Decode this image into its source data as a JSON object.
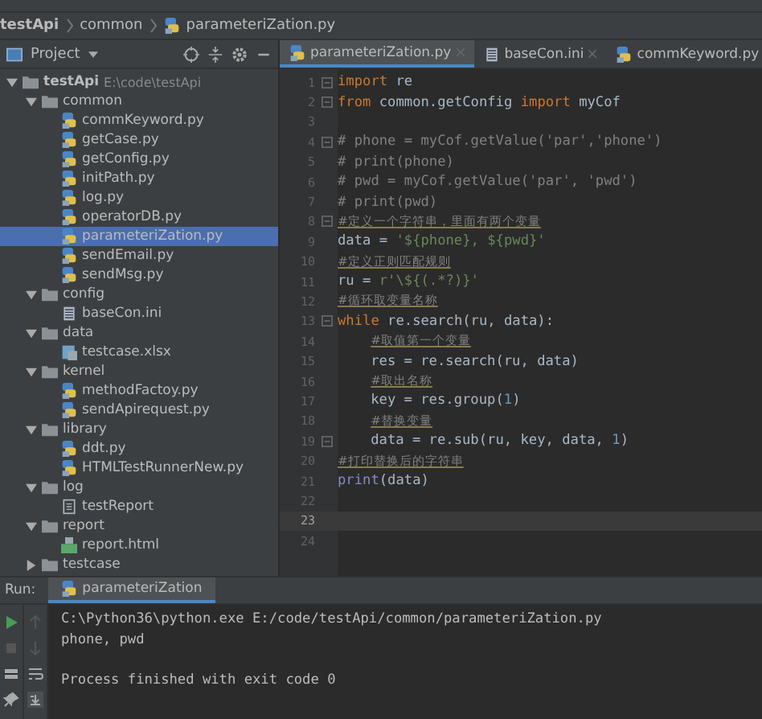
{
  "breadcrumb": [
    "testApi",
    "common",
    "parameteriZation.py"
  ],
  "project_panel": {
    "title": "Project",
    "tree": [
      {
        "label": "testApi",
        "hint": "E:\\code\\testApi",
        "kind": "folder",
        "expanded": true,
        "selected": false,
        "children": [
          {
            "label": "common",
            "kind": "folder",
            "expanded": true,
            "selected": false,
            "children": [
              {
                "label": "commKeyword.py",
                "kind": "py",
                "selected": false
              },
              {
                "label": "getCase.py",
                "kind": "py",
                "selected": false
              },
              {
                "label": "getConfig.py",
                "kind": "py",
                "selected": false
              },
              {
                "label": "initPath.py",
                "kind": "py",
                "selected": false
              },
              {
                "label": "log.py",
                "kind": "py",
                "selected": false
              },
              {
                "label": "operatorDB.py",
                "kind": "py",
                "selected": false
              },
              {
                "label": "parameteriZation.py",
                "kind": "py",
                "selected": true
              },
              {
                "label": "sendEmail.py",
                "kind": "py",
                "selected": false
              },
              {
                "label": "sendMsg.py",
                "kind": "py",
                "selected": false
              }
            ]
          },
          {
            "label": "config",
            "kind": "folder",
            "expanded": true,
            "selected": false,
            "children": [
              {
                "label": "baseCon.ini",
                "kind": "ini",
                "selected": false
              }
            ]
          },
          {
            "label": "data",
            "kind": "folder",
            "expanded": true,
            "selected": false,
            "children": [
              {
                "label": "testcase.xlsx",
                "kind": "xlsx",
                "selected": false
              }
            ]
          },
          {
            "label": "kernel",
            "kind": "folder",
            "expanded": true,
            "selected": false,
            "children": [
              {
                "label": "methodFactoy.py",
                "kind": "py",
                "selected": false
              },
              {
                "label": "sendApirequest.py",
                "kind": "py",
                "selected": false
              }
            ]
          },
          {
            "label": "library",
            "kind": "folder",
            "expanded": true,
            "selected": false,
            "children": [
              {
                "label": "ddt.py",
                "kind": "py",
                "selected": false
              },
              {
                "label": "HTMLTestRunnerNew.py",
                "kind": "py",
                "selected": false
              }
            ]
          },
          {
            "label": "log",
            "kind": "folder",
            "expanded": true,
            "selected": false,
            "children": [
              {
                "label": "testReport",
                "kind": "file",
                "selected": false
              }
            ]
          },
          {
            "label": "report",
            "kind": "folder",
            "expanded": true,
            "selected": false,
            "children": [
              {
                "label": "report.html",
                "kind": "html",
                "selected": false
              }
            ]
          },
          {
            "label": "testcase",
            "kind": "folder",
            "expanded": false,
            "selected": false
          }
        ]
      }
    ]
  },
  "editor_tabs": [
    {
      "label": "parameteriZation.py",
      "kind": "py",
      "selected": true
    },
    {
      "label": "baseCon.ini",
      "kind": "ini",
      "selected": false
    },
    {
      "label": "commKeyword.py",
      "kind": "py",
      "selected": false
    }
  ],
  "code_lines": [
    {
      "number": "1",
      "fold": true,
      "current": false,
      "indented": false,
      "tokens": [
        {
          "kind": "keyword",
          "text": "import"
        },
        {
          "kind": "plain",
          "text": " re"
        }
      ]
    },
    {
      "number": "2",
      "fold": true,
      "current": false,
      "indented": false,
      "tokens": [
        {
          "kind": "keyword",
          "text": "from"
        },
        {
          "kind": "plain",
          "text": " common.getConfig "
        },
        {
          "kind": "keyword",
          "text": "import"
        },
        {
          "kind": "plain",
          "text": " myCof"
        }
      ]
    },
    {
      "number": "3",
      "fold": false,
      "current": false
    },
    {
      "number": "4",
      "fold": true,
      "current": false,
      "indented": false,
      "tokens": [
        {
          "kind": "comment",
          "text": "# phone = myCof.getValue('par','phone')"
        }
      ]
    },
    {
      "number": "5",
      "fold": false,
      "current": false,
      "indented": false,
      "tokens": [
        {
          "kind": "comment",
          "text": "# print(phone)"
        }
      ]
    },
    {
      "number": "6",
      "fold": false,
      "current": false,
      "indented": false,
      "tokens": [
        {
          "kind": "comment",
          "text": "# pwd = myCof.getValue('par', 'pwd')"
        }
      ]
    },
    {
      "number": "7",
      "fold": false,
      "current": false,
      "indented": false,
      "tokens": [
        {
          "kind": "comment",
          "text": "# print(pwd)"
        }
      ]
    },
    {
      "number": "8",
      "fold": true,
      "current": false,
      "indented": false,
      "tokens": [
        {
          "kind": "typo",
          "text": "#定义一个字符串，里面有两个变量"
        }
      ]
    },
    {
      "number": "9",
      "fold": false,
      "current": false,
      "indented": false,
      "tokens": [
        {
          "kind": "plain",
          "text": "data = "
        },
        {
          "kind": "string",
          "text": "'${phone}, ${pwd}'"
        }
      ]
    },
    {
      "number": "10",
      "fold": false,
      "current": false,
      "indented": false,
      "tokens": [
        {
          "kind": "typo",
          "text": "#定义正则匹配规则"
        }
      ]
    },
    {
      "number": "11",
      "fold": false,
      "current": false,
      "indented": false,
      "tokens": [
        {
          "kind": "plain",
          "text": "ru = "
        },
        {
          "kind": "string",
          "text": "r'\\${(.*?)}'"
        }
      ]
    },
    {
      "number": "12",
      "fold": false,
      "current": false,
      "indented": false,
      "tokens": [
        {
          "kind": "typo",
          "text": "#循环取变量名称"
        }
      ]
    },
    {
      "number": "13",
      "fold": true,
      "current": false,
      "indented": false,
      "tokens": [
        {
          "kind": "keyword",
          "text": "while"
        },
        {
          "kind": "plain",
          "text": " re.search(ru, data):"
        }
      ]
    },
    {
      "number": "14",
      "fold": false,
      "current": false,
      "indented": true,
      "tokens": [
        {
          "kind": "typo",
          "text": "#取值第一个变量"
        }
      ]
    },
    {
      "number": "15",
      "fold": false,
      "current": false,
      "indented": true,
      "tokens": [
        {
          "kind": "plain",
          "text": "res = re.search(ru, data)"
        }
      ]
    },
    {
      "number": "16",
      "fold": false,
      "current": false,
      "indented": true,
      "tokens": [
        {
          "kind": "typo",
          "text": "#取出名称"
        }
      ]
    },
    {
      "number": "17",
      "fold": false,
      "current": false,
      "indented": true,
      "tokens": [
        {
          "kind": "plain",
          "text": "key = res.group("
        },
        {
          "kind": "number",
          "text": "1"
        },
        {
          "kind": "plain",
          "text": ")"
        }
      ]
    },
    {
      "number": "18",
      "fold": false,
      "current": false,
      "indented": true,
      "tokens": [
        {
          "kind": "typo",
          "text": "#替换变量"
        }
      ]
    },
    {
      "number": "19",
      "fold": true,
      "current": false,
      "indented": true,
      "tokens": [
        {
          "kind": "plain",
          "text": "data = re.sub(ru, key, data, "
        },
        {
          "kind": "number",
          "text": "1"
        },
        {
          "kind": "plain",
          "text": ")"
        }
      ]
    },
    {
      "number": "20",
      "fold": false,
      "current": false,
      "indented": false,
      "tokens": [
        {
          "kind": "typo",
          "text": "#打印替换后的字符串"
        }
      ]
    },
    {
      "number": "21",
      "fold": false,
      "current": false,
      "indented": false,
      "tokens": [
        {
          "kind": "builtin",
          "text": "print"
        },
        {
          "kind": "plain",
          "text": "(data)"
        }
      ]
    },
    {
      "number": "22",
      "fold": false,
      "current": false
    },
    {
      "number": "23",
      "fold": false,
      "current": true
    },
    {
      "number": "24",
      "fold": false,
      "current": false
    }
  ],
  "run_panel": {
    "label": "Run:",
    "tab": "parameteriZation",
    "output": [
      {
        "text": "C:\\Python36\\python.exe E:/code/testApi/common/parameteriZation.py",
        "kind": "command"
      },
      {
        "text": "phone, pwd",
        "kind": "stdout"
      },
      {
        "text": "Process finished with exit code 0",
        "kind": "exit"
      }
    ]
  }
}
